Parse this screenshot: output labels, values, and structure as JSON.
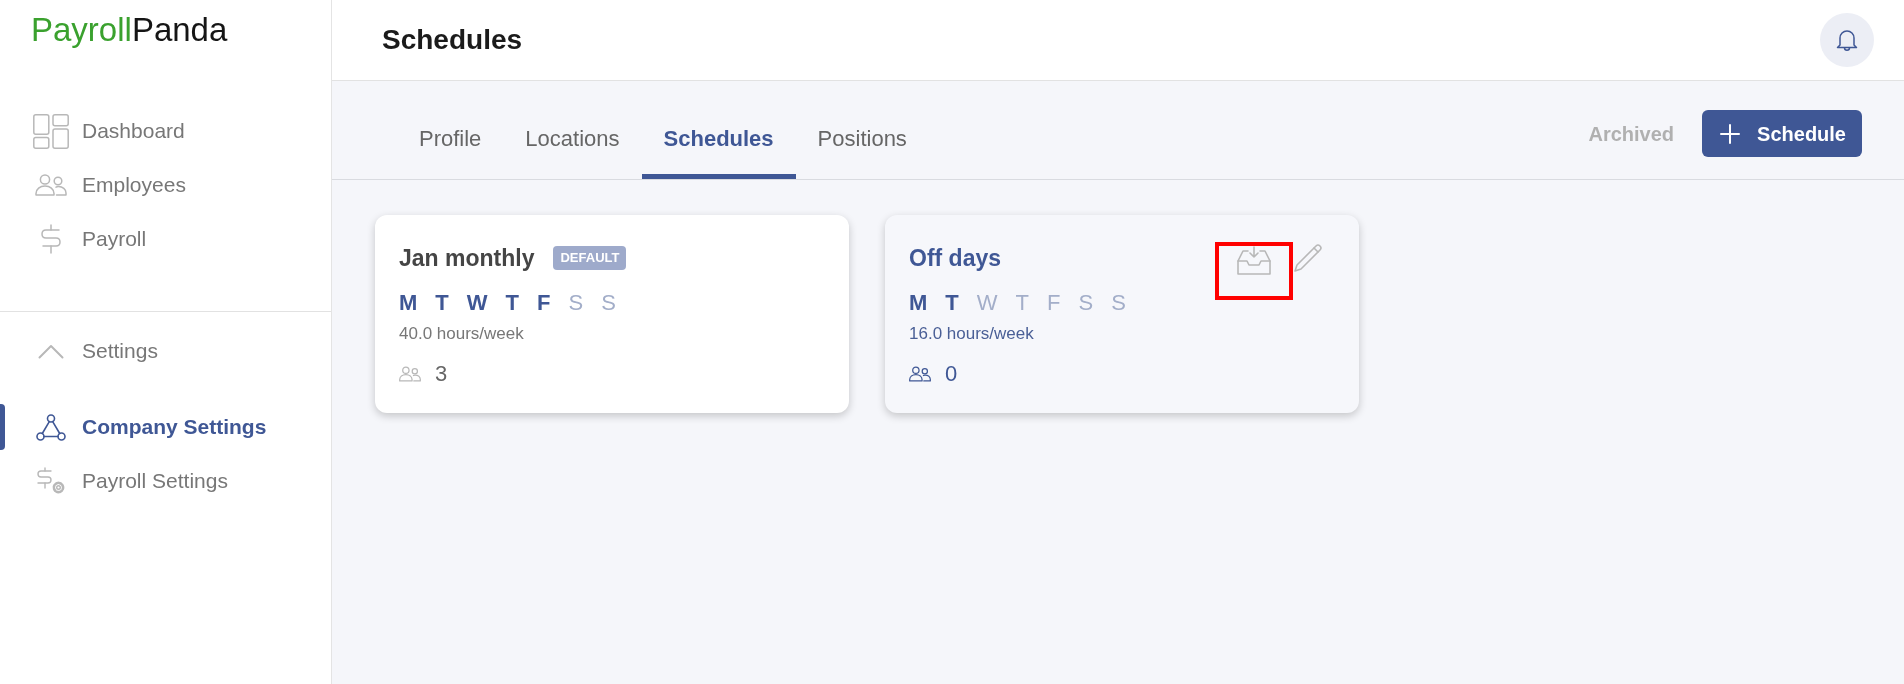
{
  "logo": {
    "first": "Payroll",
    "second": "Panda"
  },
  "sidebar": {
    "items": [
      {
        "label": "Dashboard",
        "selected": false
      },
      {
        "label": "Employees",
        "selected": false
      },
      {
        "label": "Payroll",
        "selected": false
      }
    ],
    "settings": {
      "label": "Settings",
      "expanded": true,
      "items": [
        {
          "label": "Company Settings",
          "selected": true
        },
        {
          "label": "Payroll Settings",
          "selected": false
        }
      ]
    }
  },
  "header": {
    "title": "Schedules"
  },
  "tabs": [
    {
      "label": "Profile",
      "selected": false
    },
    {
      "label": "Locations",
      "selected": false
    },
    {
      "label": "Schedules",
      "selected": true
    },
    {
      "label": "Positions",
      "selected": false
    }
  ],
  "toolbar": {
    "archived": "Archived",
    "add_button": "Schedule"
  },
  "schedules": [
    {
      "name": "Jan monthly",
      "badge": "DEFAULT",
      "hovered": false,
      "days": [
        {
          "letter": "M",
          "on": true
        },
        {
          "letter": "T",
          "on": true
        },
        {
          "letter": "W",
          "on": true
        },
        {
          "letter": "T",
          "on": true
        },
        {
          "letter": "F",
          "on": true
        },
        {
          "letter": "S",
          "on": false
        },
        {
          "letter": "S",
          "on": false
        }
      ],
      "hours": "40.0 hours/week",
      "members": "3"
    },
    {
      "name": "Off days",
      "hovered": true,
      "actions": [
        {
          "kind": "archive",
          "highlighted": true
        },
        {
          "kind": "edit",
          "highlighted": false
        }
      ],
      "days": [
        {
          "letter": "M",
          "on": true
        },
        {
          "letter": "T",
          "on": true
        },
        {
          "letter": "W",
          "on": false
        },
        {
          "letter": "T",
          "on": false
        },
        {
          "letter": "F",
          "on": false
        },
        {
          "letter": "S",
          "on": false
        },
        {
          "letter": "S",
          "on": false
        }
      ],
      "hours": "16.0 hours/week",
      "members": "0"
    }
  ]
}
